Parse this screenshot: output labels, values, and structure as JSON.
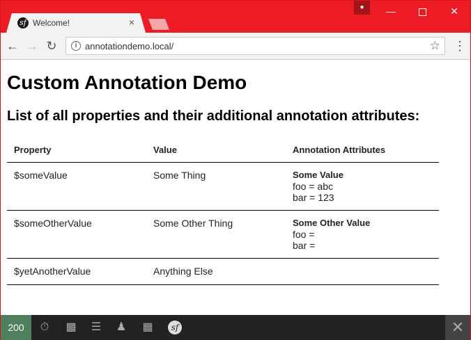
{
  "tab": {
    "title": "Welcome!",
    "close": "×"
  },
  "window_controls": {
    "minimize": "—",
    "close": "✕"
  },
  "address_bar": {
    "url": "annotationdemo.local/"
  },
  "page": {
    "title": "Custom Annotation Demo",
    "subtitle": "List of all properties and their additional annotation attributes:",
    "table": {
      "headers": [
        "Property",
        "Value",
        "Annotation Attributes"
      ],
      "rows": [
        {
          "property": "$someValue",
          "value": "Some Thing",
          "attr_name": "Some Value",
          "attr_lines": [
            "foo = abc",
            "bar = 123"
          ]
        },
        {
          "property": "$someOtherValue",
          "value": "Some Other Thing",
          "attr_name": "Some Other Value",
          "attr_lines": [
            "foo =",
            "bar ="
          ]
        },
        {
          "property": "$yetAnotherValue",
          "value": "Anything Else",
          "attr_name": "",
          "attr_lines": []
        }
      ]
    }
  },
  "debug_toolbar": {
    "status_code": "200",
    "close": "✕"
  },
  "colors": {
    "chrome_red": "#ed1c24",
    "status_green": "#4f805d",
    "toolbar_dark": "#222222"
  }
}
